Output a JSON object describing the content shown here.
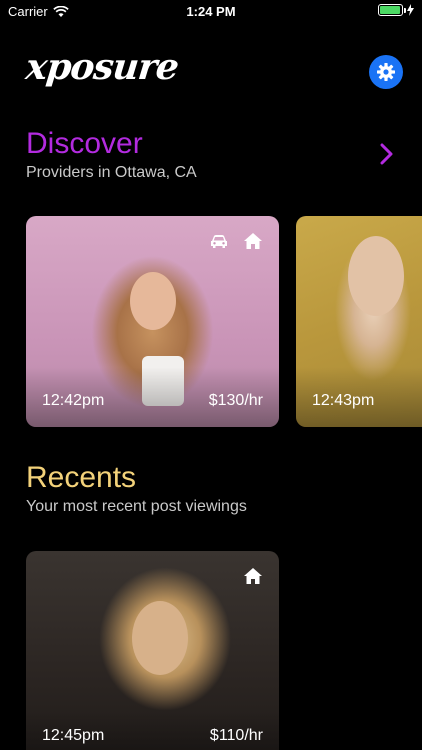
{
  "status_bar": {
    "carrier": "Carrier",
    "time": "1:24 PM",
    "battery_level": 0.95
  },
  "header": {
    "logo": "xposure",
    "settings_icon": "gear-icon"
  },
  "discover": {
    "title": "Discover",
    "subtitle": "Providers in Ottawa, CA",
    "cards": [
      {
        "time": "12:42pm",
        "price": "$130/hr",
        "icons": [
          "car-icon",
          "home-icon"
        ]
      },
      {
        "time": "12:43pm",
        "price": ""
      }
    ]
  },
  "recents": {
    "title": "Recents",
    "subtitle": "Your most recent post viewings",
    "cards": [
      {
        "time": "12:45pm",
        "price": "$110/hr",
        "icons": [
          "home-icon"
        ]
      }
    ]
  },
  "colors": {
    "discover": "#b32be0",
    "recents": "#f3d27a",
    "settings": "#1a73f5"
  }
}
